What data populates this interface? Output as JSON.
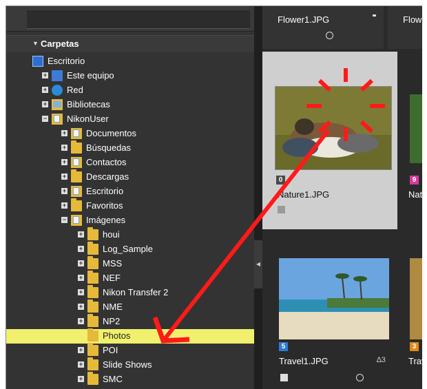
{
  "sidebar": {
    "section_title": "Carpetas",
    "items": [
      {
        "label": "Escritorio",
        "level": 0,
        "expander": "",
        "icon": "desk"
      },
      {
        "label": "Este equipo",
        "level": 1,
        "expander": "+",
        "icon": "pc"
      },
      {
        "label": "Red",
        "level": 1,
        "expander": "+",
        "icon": "net"
      },
      {
        "label": "Bibliotecas",
        "level": 1,
        "expander": "+",
        "icon": "lib"
      },
      {
        "label": "NikonUser",
        "level": 1,
        "expander": "−",
        "icon": "doc"
      },
      {
        "label": "Documentos",
        "level": 2,
        "expander": "+",
        "icon": "doc"
      },
      {
        "label": "Búsquedas",
        "level": 2,
        "expander": "+",
        "icon": "folder"
      },
      {
        "label": "Contactos",
        "level": 2,
        "expander": "+",
        "icon": "doc"
      },
      {
        "label": "Descargas",
        "level": 2,
        "expander": "+",
        "icon": "folder"
      },
      {
        "label": "Escritorio",
        "level": 2,
        "expander": "+",
        "icon": "doc"
      },
      {
        "label": "Favoritos",
        "level": 2,
        "expander": "+",
        "icon": "folder"
      },
      {
        "label": "Imágenes",
        "level": 2,
        "expander": "−",
        "icon": "doc"
      },
      {
        "label": "houi",
        "level": 3,
        "expander": "+",
        "icon": "folder"
      },
      {
        "label": "Log_Sample",
        "level": 3,
        "expander": "+",
        "icon": "folder"
      },
      {
        "label": "MSS",
        "level": 3,
        "expander": "+",
        "icon": "folder"
      },
      {
        "label": "NEF",
        "level": 3,
        "expander": "+",
        "icon": "folder"
      },
      {
        "label": "Nikon Transfer 2",
        "level": 3,
        "expander": "+",
        "icon": "folder"
      },
      {
        "label": "NME",
        "level": 3,
        "expander": "+",
        "icon": "folder"
      },
      {
        "label": "NP2",
        "level": 3,
        "expander": "+",
        "icon": "folder"
      },
      {
        "label": "Photos",
        "level": 3,
        "expander": "",
        "icon": "folder",
        "selected": true
      },
      {
        "label": "POI",
        "level": 3,
        "expander": "+",
        "icon": "folder"
      },
      {
        "label": "Slide Shows",
        "level": 3,
        "expander": "+",
        "icon": "folder"
      },
      {
        "label": "SMC",
        "level": 3,
        "expander": "+",
        "icon": "folder"
      }
    ]
  },
  "grid": {
    "header_name": "Flower1.JPG",
    "header_name2": "Flow",
    "cells": [
      {
        "name": "Nature1.JPG",
        "badge": "0",
        "badge_color": "#4a4a4a"
      },
      {
        "name": "Natu",
        "badge": "9",
        "badge_color": "#d6399b"
      },
      {
        "name": "Travel1.JPG",
        "badge": "5",
        "badge_color": "#2f7ad6",
        "extra": "∆3"
      },
      {
        "name": "Trave",
        "badge": "3",
        "badge_color": "#e08a1a"
      }
    ]
  },
  "colors": {
    "annotation": "#ff1a1a",
    "selection": "#f0f06e"
  }
}
